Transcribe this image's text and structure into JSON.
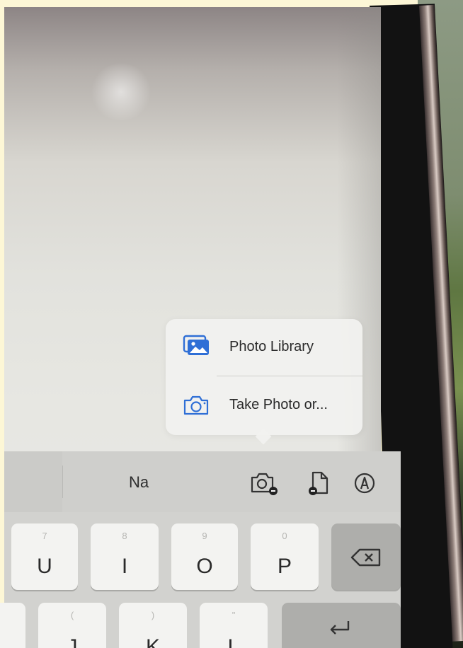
{
  "popup_menu": {
    "items": [
      {
        "label": "Photo Library",
        "icon": "photo-library-icon"
      },
      {
        "label": "Take Photo or...",
        "icon": "camera-icon"
      }
    ]
  },
  "keyboard_toolbar": {
    "suggestion": "Na",
    "tools": [
      "camera-badge-icon",
      "document-badge-icon",
      "markup-icon"
    ]
  },
  "keyboard": {
    "row1": [
      {
        "hint": "7",
        "label": "U"
      },
      {
        "hint": "8",
        "label": "I"
      },
      {
        "hint": "9",
        "label": "O"
      },
      {
        "hint": "0",
        "label": "P"
      }
    ],
    "row2": [
      {
        "hint": "(",
        "label": "J"
      },
      {
        "hint": ")",
        "label": "K"
      },
      {
        "hint": "\"",
        "label": "L"
      }
    ],
    "special_keys": [
      "delete-key",
      "return-key"
    ]
  },
  "colors": {
    "accent": "#2f6fd6",
    "key": "#f3f3f1",
    "key_special": "#aeaeab",
    "toolbar": "#cfcfcc"
  }
}
